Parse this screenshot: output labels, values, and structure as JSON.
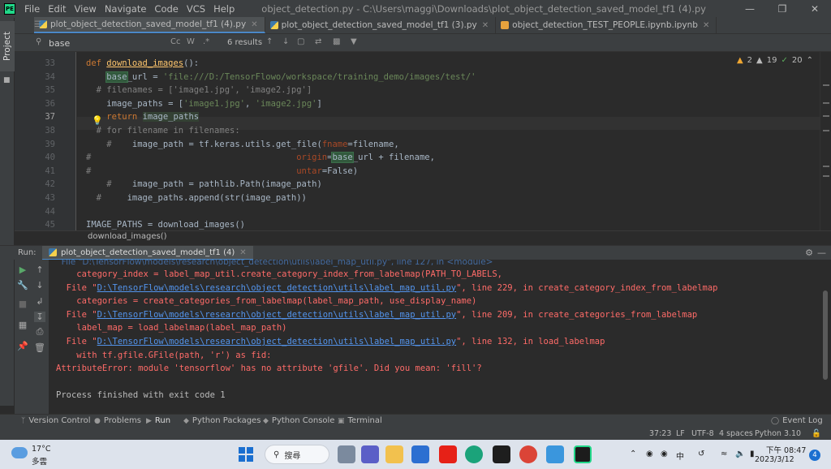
{
  "titlebar": {
    "logo_text": "PE",
    "menu": [
      "File",
      "Edit",
      "View",
      "Navigate",
      "Code",
      "VCS",
      "Help"
    ],
    "window_title": "object_detection.py - C:\\Users\\maggi\\Downloads\\plot_object_detection_saved_model_tf1 (4).py"
  },
  "sidebar": {
    "project_label": "Project"
  },
  "tabs": [
    {
      "label": "plot_object_detection_saved_model_tf1 (4).py",
      "active": true
    },
    {
      "label": "plot_object_detection_saved_model_tf1 (3).py",
      "active": false
    },
    {
      "label": "object_detection_TEST_PEOPLE.ipynb.ipynb",
      "active": false
    }
  ],
  "search": {
    "value": "base",
    "results": "6 results",
    "options": [
      "Cc",
      "W",
      ".*"
    ]
  },
  "inspections": {
    "warnings": "2",
    "weak_warnings": "19",
    "ok": "20"
  },
  "editor": {
    "lines": [
      {
        "n": "33",
        "html": "<span class=\"kw\">def</span> <span class=\"fn\">download_images</span>():"
      },
      {
        "n": "34",
        "html": "    <span class=\"hl\">base</span>_url = <span class=\"str\">'file:///D:/TensorFlowo/workspace/training_demo/images/test/'</span>"
      },
      {
        "n": "35",
        "html": "  <span class=\"cm\"># filenames = ['image1.jpg', 'image2.jpg']</span>"
      },
      {
        "n": "36",
        "html": "    image_paths = [<span class=\"str\">'image1.jpg'</span>, <span class=\"str\">'image2.jpg'</span>]"
      },
      {
        "n": "37",
        "html": "    <span class=\"kw\">return</span> <span class=\"hl2\">image_paths</span>"
      },
      {
        "n": "38",
        "html": "  <span class=\"cm\"># for filename in filenames:</span>"
      },
      {
        "n": "39",
        "html": "    <span class=\"cm\">#</span>    image_path = tf.keras.utils.get_file(<span class=\"prm\">fname</span>=filename,"
      },
      {
        "n": "40",
        "html": "<span class=\"cm\">#</span>                                        <span class=\"prm\">origin</span>=<span class=\"hl\">base</span>_url + filename,"
      },
      {
        "n": "41",
        "html": "<span class=\"cm\">#</span>                                        <span class=\"prm\">untar</span>=False)"
      },
      {
        "n": "42",
        "html": "    <span class=\"cm\">#</span>    image_path = pathlib.Path(image_path)"
      },
      {
        "n": "43",
        "html": "  <span class=\"cm\">#</span>     image_paths.append(str(image_path))"
      },
      {
        "n": "44",
        "html": ""
      },
      {
        "n": "45",
        "html": "IMAGE_PATHS = download_images()"
      }
    ],
    "breadcrumb": "download_images()"
  },
  "run": {
    "label": "Run:",
    "tab": "plot_object_detection_saved_model_tf1 (4)",
    "console": [
      {
        "cls": "",
        "html": "    category_index = label_map_util.create_category_index_from_labelmap(PATH_TO_LABELS,"
      },
      {
        "cls": "",
        "html": "  File \"<a>D:\\TensorFlow\\models\\research\\object_detection\\utils\\label_map_util.py</a>\", line 229, in create_category_index_from_labelmap"
      },
      {
        "cls": "",
        "html": "    categories = create_categories_from_labelmap(label_map_path, use_display_name)"
      },
      {
        "cls": "",
        "html": "  File \"<a>D:\\TensorFlow\\models\\research\\object_detection\\utils\\label_map_util.py</a>\", line 209, in create_categories_from_labelmap"
      },
      {
        "cls": "",
        "html": "    label_map = load_labelmap(label_map_path)"
      },
      {
        "cls": "",
        "html": "  File \"<a>D:\\TensorFlow\\models\\research\\object_detection\\utils\\label_map_util.py</a>\", line 132, in load_labelmap"
      },
      {
        "cls": "",
        "html": "    with tf.gfile.GFile(path, 'r') as fid:"
      },
      {
        "cls": "",
        "html": "AttributeError: module 'tensorflow' has no attribute 'gfile'. Did you mean: 'fill'?"
      },
      {
        "cls": "plain",
        "html": ""
      },
      {
        "cls": "plain",
        "html": "Process finished with exit code 1"
      }
    ]
  },
  "bottom_tools": [
    {
      "label": "Version Control",
      "icon": "branch-icon"
    },
    {
      "label": "Problems",
      "icon": "problems-icon"
    },
    {
      "label": "Run",
      "icon": "run-icon",
      "active": true
    },
    {
      "label": "Python Packages",
      "icon": "packages-icon"
    },
    {
      "label": "Python Console",
      "icon": "console-icon"
    },
    {
      "label": "Terminal",
      "icon": "terminal-icon"
    }
  ],
  "event_log": "Event Log",
  "status": {
    "position": "37:23",
    "line_sep": "LF",
    "encoding": "UTF-8",
    "indent": "4 spaces",
    "interpreter": "Python 3.10"
  },
  "taskbar": {
    "weather_temp": "17°C",
    "weather_desc": "多雲",
    "search_label": "搜尋",
    "ime": "中",
    "time": "下午 08:47",
    "date": "2023/3/12",
    "notifications": "4"
  },
  "colors": {
    "accent": "#4a88c7",
    "error": "#ff6b68",
    "link": "#5394ec",
    "pycharm": "#21d789"
  }
}
